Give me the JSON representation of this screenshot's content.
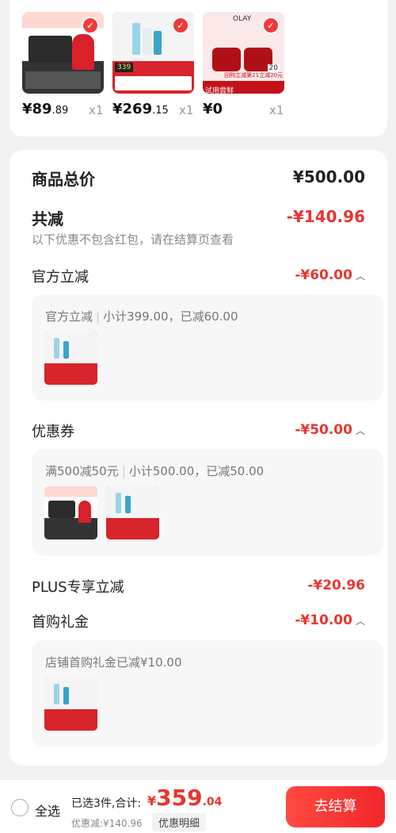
{
  "products": [
    {
      "price_int": "¥89",
      "price_dec": ".89",
      "qty": "x1"
    },
    {
      "price_int": "¥269",
      "price_dec": ".15",
      "qty": "x1"
    },
    {
      "price_int": "¥0",
      "price_dec": "",
      "qty": "x1",
      "badge": "试用尝鲜",
      "tag_text": "回购立减第21立减20元",
      "brand": "OLAY",
      "num": "20"
    }
  ],
  "skin_tag": "339",
  "summary": {
    "goods_total_label": "商品总价",
    "goods_total_value": "¥500.00",
    "total_reduce_label": "共减",
    "total_reduce_value": "-¥140.96",
    "note": "以下优惠不包含红包，请在结算页查看"
  },
  "official": {
    "title": "官方立减",
    "amount": "-¥60.00",
    "detail_a": "官方立减",
    "detail_b": "小计399.00，已减60.00"
  },
  "coupon": {
    "title": "优惠券",
    "amount": "-¥50.00",
    "detail_a": "满500减50元",
    "detail_b": "小计500.00，已减50.00"
  },
  "plus": {
    "title": "PLUS专享立减",
    "amount": "-¥20.96"
  },
  "first_gift": {
    "title": "首购礼金",
    "amount": "-¥10.00",
    "detail": "店铺首购礼金已减¥10.00"
  },
  "bottom": {
    "select_all": "全选",
    "selected": "已选3件,合计:",
    "total_yen": "¥",
    "total_int": "359",
    "total_dec": ".04",
    "saved": "优惠减:¥140.96",
    "detail_btn": "优惠明细",
    "checkout": "去结算"
  },
  "icons": {
    "check": "check-icon",
    "caret": "chevron-up-icon"
  },
  "colors": {
    "accent": "#e8352f",
    "checkout_bg": "#f2272b"
  }
}
